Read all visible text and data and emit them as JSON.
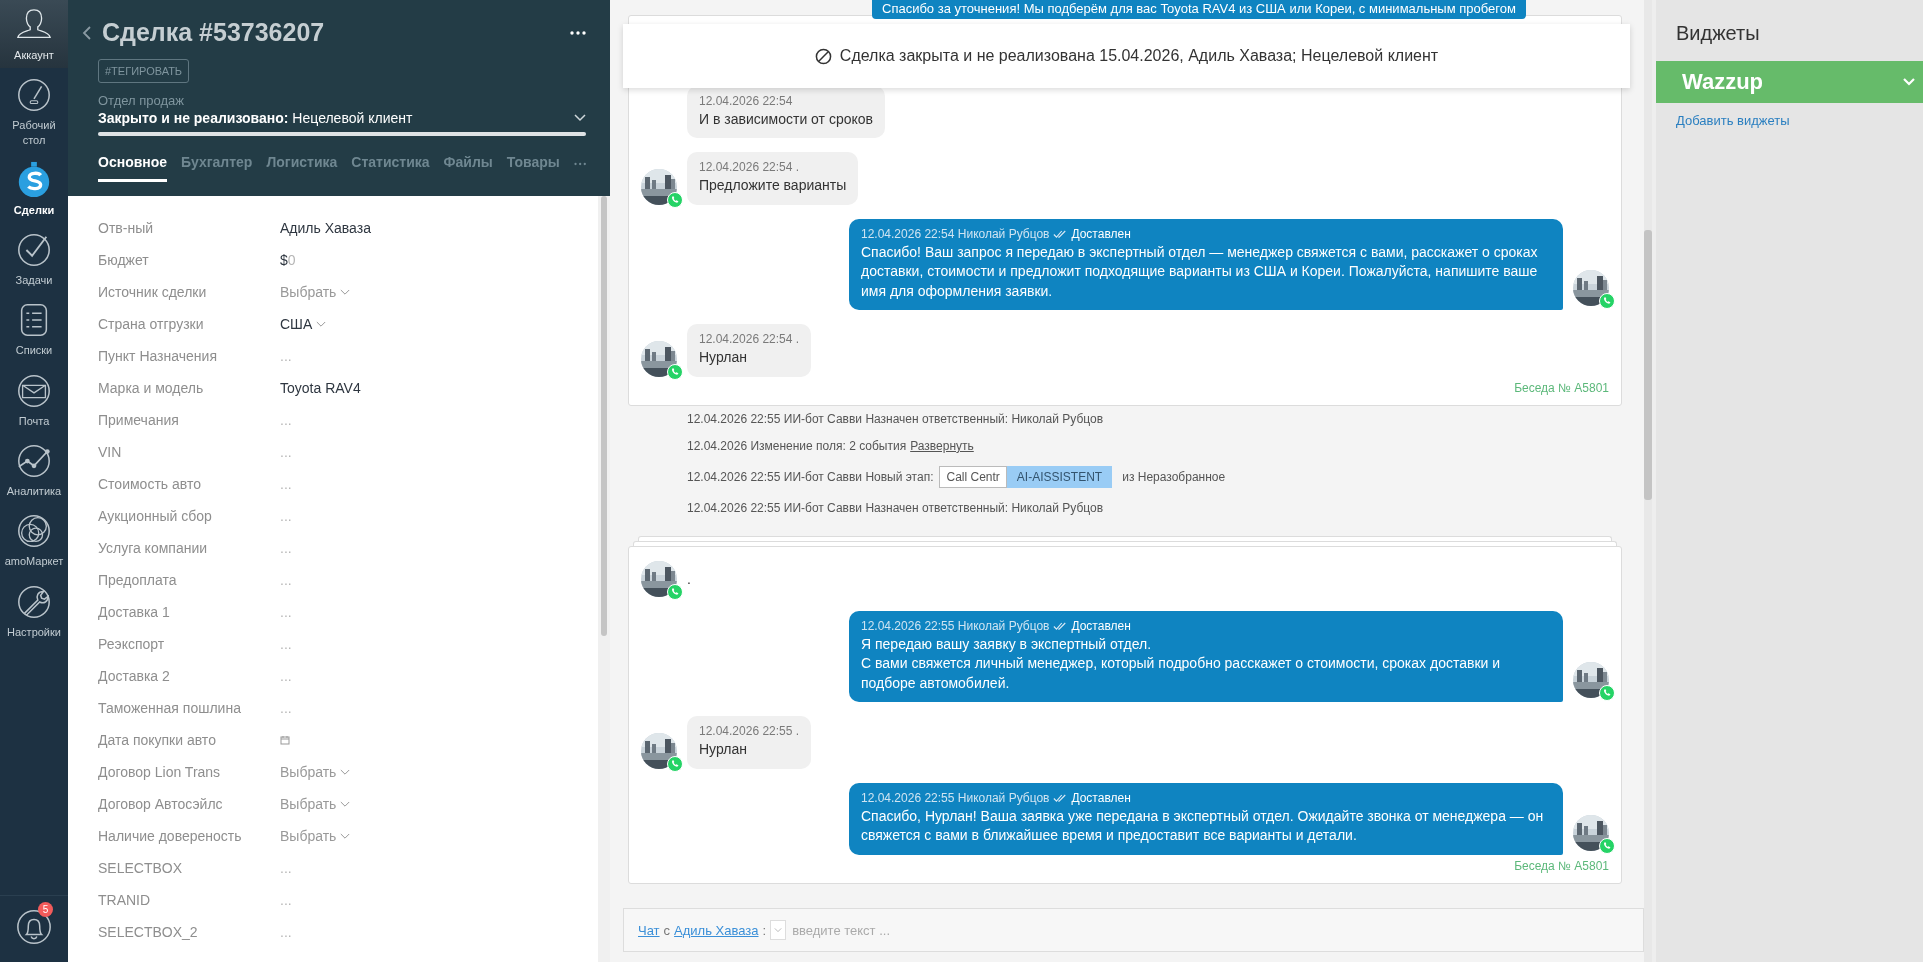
{
  "nav": {
    "items": [
      {
        "label": "Аккаунт",
        "kind": "account",
        "selected": false
      },
      {
        "label": "Рабочий стол",
        "kind": "dashboard",
        "selected": false
      },
      {
        "label": "Сделки",
        "kind": "deals",
        "selected": true
      },
      {
        "label": "Задачи",
        "kind": "tasks",
        "selected": false
      },
      {
        "label": "Списки",
        "kind": "lists",
        "selected": false
      },
      {
        "label": "Почта",
        "kind": "mail",
        "selected": false
      },
      {
        "label": "Аналитика",
        "kind": "analytics",
        "selected": false
      },
      {
        "label": "amoМаркет",
        "kind": "market",
        "selected": false
      },
      {
        "label": "Настройки",
        "kind": "settings",
        "selected": false
      }
    ],
    "notifications": {
      "badge": "5"
    }
  },
  "header": {
    "title": "Сделка #53736207",
    "tag_button": "#ТЕГИРОВАТЬ",
    "pipeline": {
      "name": "Отдел продаж",
      "status": "**Закрыто и не реализовано:** Нецелевой клиент",
      "level": 1
    },
    "tabs": [
      {
        "label": "Основное",
        "selected": true
      },
      {
        "label": "Бухгалтер",
        "selected": false
      },
      {
        "label": "Логистика",
        "selected": false
      },
      {
        "label": "Статистика",
        "selected": false
      },
      {
        "label": "Файлы",
        "selected": false
      },
      {
        "label": "Товары",
        "selected": false
      }
    ]
  },
  "fields": [
    {
      "label": "Отв-ный",
      "kind": "text",
      "value": "Адиль Хаваза"
    },
    {
      "label": "Бюджет",
      "kind": "money",
      "currency": "$",
      "value": "0"
    },
    {
      "label": "Источник сделки",
      "kind": "select",
      "placeholder": "Выбрать"
    },
    {
      "label": "Страна отгрузки",
      "kind": "select-set",
      "value": "США"
    },
    {
      "label": "Пункт Назначения",
      "kind": "empty",
      "placeholder": "..."
    },
    {
      "label": "Марка и модель",
      "kind": "text",
      "value": "Toyota RAV4"
    },
    {
      "label": "Примечания",
      "kind": "empty",
      "placeholder": "..."
    },
    {
      "label": "VIN",
      "kind": "empty",
      "placeholder": "..."
    },
    {
      "label": "Стоимость авто",
      "kind": "empty",
      "placeholder": "..."
    },
    {
      "label": "Аукционный сбор",
      "kind": "empty",
      "placeholder": "..."
    },
    {
      "label": "Услуга компании",
      "kind": "empty",
      "placeholder": "..."
    },
    {
      "label": "Предоплата",
      "kind": "empty",
      "placeholder": "..."
    },
    {
      "label": "Доставка 1",
      "kind": "empty",
      "placeholder": "..."
    },
    {
      "label": "Реэкспорт",
      "kind": "empty",
      "placeholder": "..."
    },
    {
      "label": "Доставка 2",
      "kind": "empty",
      "placeholder": "..."
    },
    {
      "label": "Таможенная пошлина",
      "kind": "empty",
      "placeholder": "..."
    },
    {
      "label": "Дата покупки авто",
      "kind": "date"
    },
    {
      "label": "Договор Lion Trans",
      "kind": "select",
      "placeholder": "Выбрать"
    },
    {
      "label": "Договор Автосэйлс",
      "kind": "select",
      "placeholder": "Выбрать"
    },
    {
      "label": "Наличие довереность",
      "kind": "select",
      "placeholder": "Выбрать"
    },
    {
      "label": "SELECTBOX",
      "kind": "empty",
      "placeholder": "..."
    },
    {
      "label": "TRANID",
      "kind": "empty",
      "placeholder": "..."
    },
    {
      "label": "SELECTBOX_2",
      "kind": "empty",
      "placeholder": "..."
    }
  ],
  "chat": {
    "top_message": "Спасибо за уточнения! Мы подберём для вас Toyota RAV4 из США или Кореи, с минимальным пробегом",
    "notice": "Сделка закрыта и не реализована 15.04.2026, Адиль Хаваза; Нецелевой клиент",
    "feed": [
      {
        "kind": "card",
        "stacked": false,
        "footer": "Беседа № A5801",
        "messages": [
          {
            "kind": "incoming",
            "avatar": false,
            "meta": "12.04.2026 22:54",
            "text": "И в зависимости от сроков"
          },
          {
            "kind": "incoming",
            "avatar": true,
            "meta": "12.04.2026 22:54 .",
            "text": "Предложите варианты"
          },
          {
            "kind": "outgoing",
            "avatar": true,
            "meta": "12.04.2026 22:54 Николай Рубцов",
            "status": "Доставлен",
            "text": "Спасибо! Ваш запрос я передаю в экспертный отдел — менеджер свяжется с вами, расскажет о сроках доставки, стоимости и предложит подходящие варианты из США и Кореи. Пожалуйста, напишите ваше имя для оформления заявки."
          },
          {
            "kind": "incoming",
            "avatar": true,
            "meta": "12.04.2026 22:54 .",
            "text": "Нурлан"
          }
        ]
      },
      {
        "kind": "event",
        "text": "12.04.2026 22:55 ИИ-бот Савви Назначен ответственный: Николай Рубцов"
      },
      {
        "kind": "link-event",
        "text": "12.04.2026 Изменение поля: 2 события",
        "link": "Развернуть"
      },
      {
        "kind": "stage-event",
        "text": "12.04.2026 22:55 ИИ-бот Савви Новый этап:",
        "from": "Call Centr",
        "to": "AI-AISSISTENT",
        "tail": "из Неразобранное"
      },
      {
        "kind": "event",
        "text": "12.04.2026 22:55 ИИ-бот Савви Назначен ответственный: Николай Рубцов"
      },
      {
        "kind": "card",
        "stacked": true,
        "footer": "Беседа № A5801",
        "messages": [
          {
            "kind": "incoming",
            "avatar": true,
            "text": "."
          },
          {
            "kind": "outgoing",
            "avatar": true,
            "meta": "12.04.2026 22:55 Николай Рубцов",
            "status": "Доставлен",
            "text": "Я передаю вашу заявку в экспертный отдел.\nС вами свяжется личный менеджер, который подробно расскажет о стоимости, сроках доставки и подборе автомобилей."
          },
          {
            "kind": "incoming",
            "avatar": true,
            "meta": "12.04.2026 22:55 .",
            "text": "Нурлан"
          },
          {
            "kind": "outgoing",
            "avatar": true,
            "meta": "12.04.2026 22:55 Николай Рубцов",
            "status": "Доставлен",
            "text": "Спасибо, Нурлан! Ваша заявка уже передана в экспертный отдел. Ожидайте звонка от менеджера — он свяжется с вами в ближайшее время и предоставит все варианты и детали."
          }
        ]
      }
    ],
    "composer": {
      "mode": "Чат",
      "connector": "с",
      "recipient": "Адиль Хаваза",
      "separator": ":",
      "placeholder": "введите текст ..."
    }
  },
  "widgets": {
    "title": "Виджеты",
    "items": [
      {
        "name": "Wazzup",
        "expanded": false
      }
    ],
    "add_link": "Добавить виджеты"
  }
}
